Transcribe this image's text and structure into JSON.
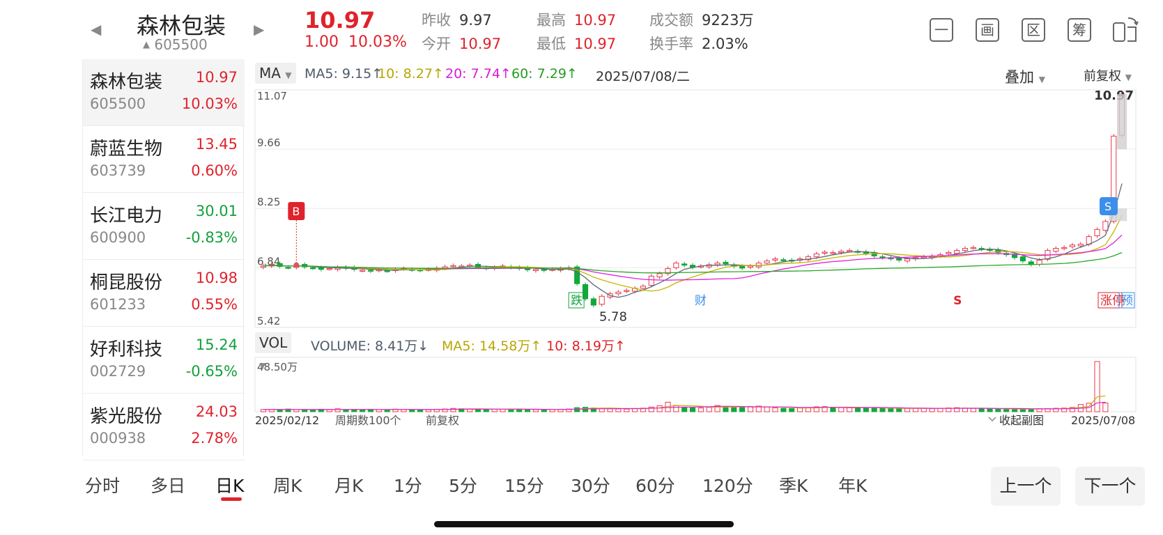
{
  "header": {
    "stock_name": "森林包装",
    "stock_code": "605500",
    "price": "10.97",
    "change": "1.00",
    "change_pct": "10.03%",
    "prev_close_label": "昨收",
    "prev_close": "9.97",
    "open_label": "今开",
    "open": "10.97",
    "high_label": "最高",
    "high": "10.97",
    "low_label": "最低",
    "low": "10.97",
    "turnover_label": "成交额",
    "turnover": "9223万",
    "turnover_rate_label": "换手率",
    "turnover_rate": "2.03%",
    "icons": [
      "minus-box-icon",
      "picture-box-icon",
      "district-box-icon",
      "chip-box-icon",
      "rotate-screen-icon"
    ],
    "icon_glyphs": [
      "一",
      "画",
      "区",
      "筹",
      ""
    ]
  },
  "watchlist": [
    {
      "name": "森林包装",
      "code": "605500",
      "price": "10.97",
      "pct": "10.03%",
      "dir": "up"
    },
    {
      "name": "蔚蓝生物",
      "code": "603739",
      "price": "13.45",
      "pct": "0.60%",
      "dir": "up"
    },
    {
      "name": "长江电力",
      "code": "600900",
      "price": "30.01",
      "pct": "-0.83%",
      "dir": "down"
    },
    {
      "name": "桐昆股份",
      "code": "601233",
      "price": "10.98",
      "pct": "0.55%",
      "dir": "up"
    },
    {
      "name": "好利科技",
      "code": "002729",
      "price": "15.24",
      "pct": "-0.65%",
      "dir": "down"
    },
    {
      "name": "紫光股份",
      "code": "000938",
      "price": "24.03",
      "pct": "2.78%",
      "dir": "up"
    }
  ],
  "toolbar": {
    "ma_select": "MA",
    "ma5": "MA5: 9.15↑",
    "ma10": "10: 8.27↑",
    "ma20": "20: 7.74↑",
    "ma60": "60: 7.29↑",
    "date": "2025/07/08/二",
    "overlay": "叠加",
    "adjust": "前复权"
  },
  "vol_toolbar": {
    "vol_select": "VOL",
    "volume": "VOLUME: 8.41万↓",
    "ma5": "MA5: 14.58万↑",
    "ma10": "10: 8.19万↑"
  },
  "chart_data": {
    "type": "candlestick",
    "price_axis_labels": [
      "11.07",
      "9.66",
      "8.25",
      "6.84",
      "5.42"
    ],
    "ylim": [
      5.42,
      11.07
    ],
    "high_marker": "10.97",
    "low_marker": "5.78",
    "volume_axis_label": "48.50万",
    "x_start": "2025/02/12",
    "x_end": "2025/07/08",
    "period_count": "周期数100个",
    "adjust_note": "前复权",
    "collapse_label": "收起副图",
    "event_tags": [
      "跌",
      "财",
      "S",
      "涨停",
      "预"
    ],
    "signal_buy": "B",
    "signal_sell": "S",
    "colors": {
      "up": "#e8384a",
      "down": "#12a83a",
      "ma5": "#5b6a7a",
      "ma10": "#c8b400",
      "ma20": "#e020e0",
      "ma60": "#2aa82a"
    },
    "close_series": [
      6.88,
      6.92,
      6.87,
      6.85,
      6.9,
      6.86,
      6.84,
      6.8,
      6.82,
      6.85,
      6.83,
      6.8,
      6.78,
      6.76,
      6.79,
      6.77,
      6.8,
      6.82,
      6.79,
      6.78,
      6.8,
      6.83,
      6.86,
      6.89,
      6.88,
      6.9,
      6.86,
      6.83,
      6.85,
      6.88,
      6.85,
      6.82,
      6.79,
      6.8,
      6.78,
      6.8,
      6.82,
      6.84,
      6.46,
      6.1,
      5.95,
      6.16,
      6.22,
      6.26,
      6.3,
      6.35,
      6.4,
      6.64,
      6.7,
      6.82,
      6.95,
      6.9,
      6.85,
      6.88,
      6.91,
      6.95,
      6.93,
      6.87,
      6.83,
      6.88,
      6.95,
      7.0,
      7.05,
      7.02,
      7.0,
      7.05,
      7.1,
      7.17,
      7.21,
      7.2,
      7.23,
      7.25,
      7.22,
      7.18,
      7.12,
      7.08,
      7.05,
      7.02,
      7.05,
      7.08,
      7.1,
      7.12,
      7.15,
      7.2,
      7.25,
      7.3,
      7.32,
      7.28,
      7.25,
      7.2,
      7.15,
      7.08,
      7.0,
      6.92,
      7.02,
      7.25,
      7.3,
      7.32,
      7.38,
      7.4,
      7.58,
      7.75,
      7.94,
      9.97,
      10.97
    ],
    "volume_series_wan": [
      2.1,
      2.3,
      1.8,
      2.6,
      2.0,
      1.9,
      1.7,
      2.4,
      2.2,
      2.8,
      2.0,
      1.9,
      2.1,
      2.4,
      2.0,
      1.8,
      2.5,
      2.3,
      2.1,
      2.0,
      1.9,
      2.4,
      2.6,
      3.2,
      2.9,
      2.7,
      2.4,
      2.2,
      2.5,
      2.3,
      2.1,
      2.6,
      2.3,
      2.0,
      1.9,
      2.2,
      2.4,
      2.6,
      3.9,
      4.3,
      3.6,
      3.1,
      2.8,
      2.7,
      2.5,
      2.9,
      3.4,
      4.5,
      5.8,
      9.2,
      6.1,
      4.3,
      3.9,
      3.6,
      4.2,
      6.0,
      4.8,
      4.1,
      4.4,
      5.1,
      5.4,
      4.6,
      3.8,
      3.3,
      3.0,
      3.6,
      4.0,
      4.7,
      4.9,
      4.4,
      4.0,
      3.9,
      4.2,
      3.8,
      3.5,
      3.1,
      2.9,
      3.0,
      3.2,
      3.4,
      3.1,
      2.9,
      3.3,
      3.6,
      3.9,
      3.5,
      3.2,
      3.0,
      2.8,
      2.6,
      2.7,
      2.5,
      2.4,
      2.6,
      2.9,
      3.0,
      3.3,
      3.5,
      4.1,
      7.0,
      8.2,
      48.5,
      8.41
    ]
  },
  "tabs": [
    "分时",
    "多日",
    "日K",
    "周K",
    "月K",
    "1分",
    "5分",
    "15分",
    "30分",
    "60分",
    "120分",
    "季K",
    "年K"
  ],
  "active_tab": "日K",
  "nav": {
    "prev": "上一个",
    "next": "下一个"
  }
}
